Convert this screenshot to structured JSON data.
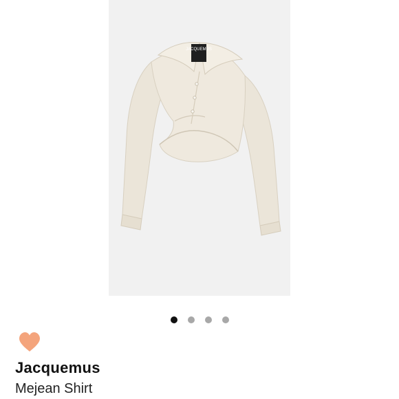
{
  "product": {
    "brand": "Jacquemus",
    "name": "Mejean Shirt",
    "image_icon": "shirt-product-photo",
    "label_text": "JACQUEMUS"
  },
  "carousel": {
    "total": 4,
    "active_index": 0
  },
  "favorite": {
    "icon": "heart-icon",
    "color": "#f4a47c"
  }
}
